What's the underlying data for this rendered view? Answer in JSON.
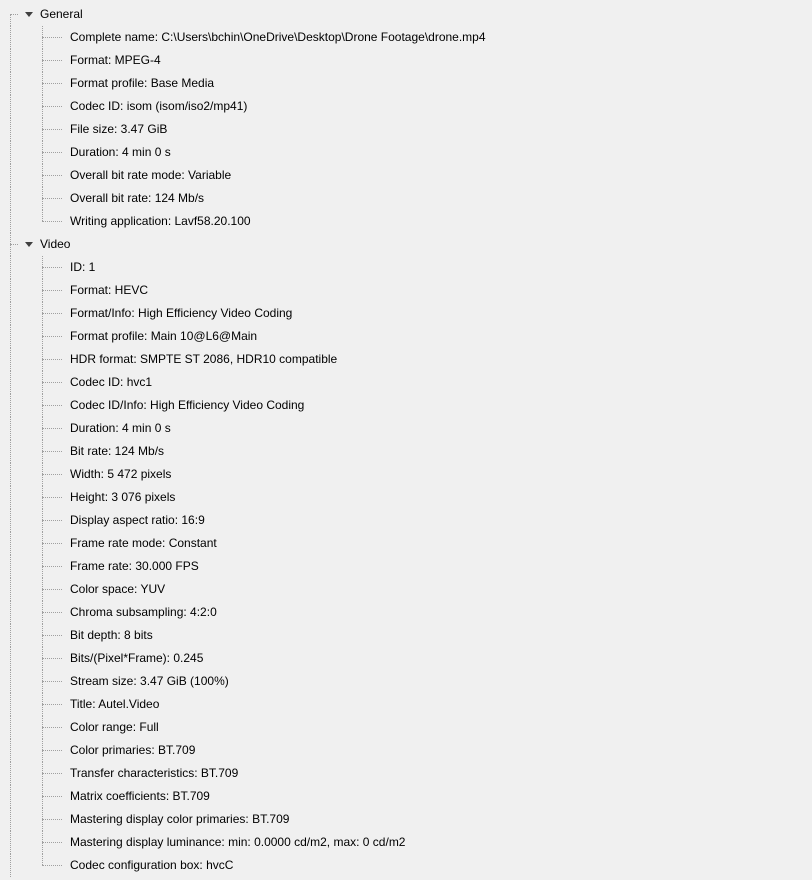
{
  "tree": [
    {
      "label": "General",
      "expanded": true,
      "children": [
        "Complete name: C:\\Users\\bchin\\OneDrive\\Desktop\\Drone Footage\\drone.mp4",
        "Format: MPEG-4",
        "Format profile: Base Media",
        "Codec ID: isom (isom/iso2/mp41)",
        "File size: 3.47 GiB",
        "Duration: 4 min 0 s",
        "Overall bit rate mode: Variable",
        "Overall bit rate: 124 Mb/s",
        "Writing application: Lavf58.20.100"
      ]
    },
    {
      "label": "Video",
      "expanded": true,
      "children": [
        "ID: 1",
        "Format: HEVC",
        "Format/Info: High Efficiency Video Coding",
        "Format profile: Main 10@L6@Main",
        "HDR format: SMPTE ST 2086, HDR10 compatible",
        "Codec ID: hvc1",
        "Codec ID/Info: High Efficiency Video Coding",
        "Duration: 4 min 0 s",
        "Bit rate: 124 Mb/s",
        "Width: 5 472 pixels",
        "Height: 3 076 pixels",
        "Display aspect ratio: 16:9",
        "Frame rate mode: Constant",
        "Frame rate: 30.000 FPS",
        "Color space: YUV",
        "Chroma subsampling: 4:2:0",
        "Bit depth: 8 bits",
        "Bits/(Pixel*Frame): 0.245",
        "Stream size: 3.47 GiB (100%)",
        "Title: Autel.Video",
        "Color range: Full",
        "Color primaries: BT.709",
        "Transfer characteristics: BT.709",
        "Matrix coefficients: BT.709",
        "Mastering display color primaries: BT.709",
        "Mastering display luminance: min: 0.0000 cd/m2, max: 0 cd/m2",
        "Codec configuration box: hvcC"
      ]
    }
  ]
}
